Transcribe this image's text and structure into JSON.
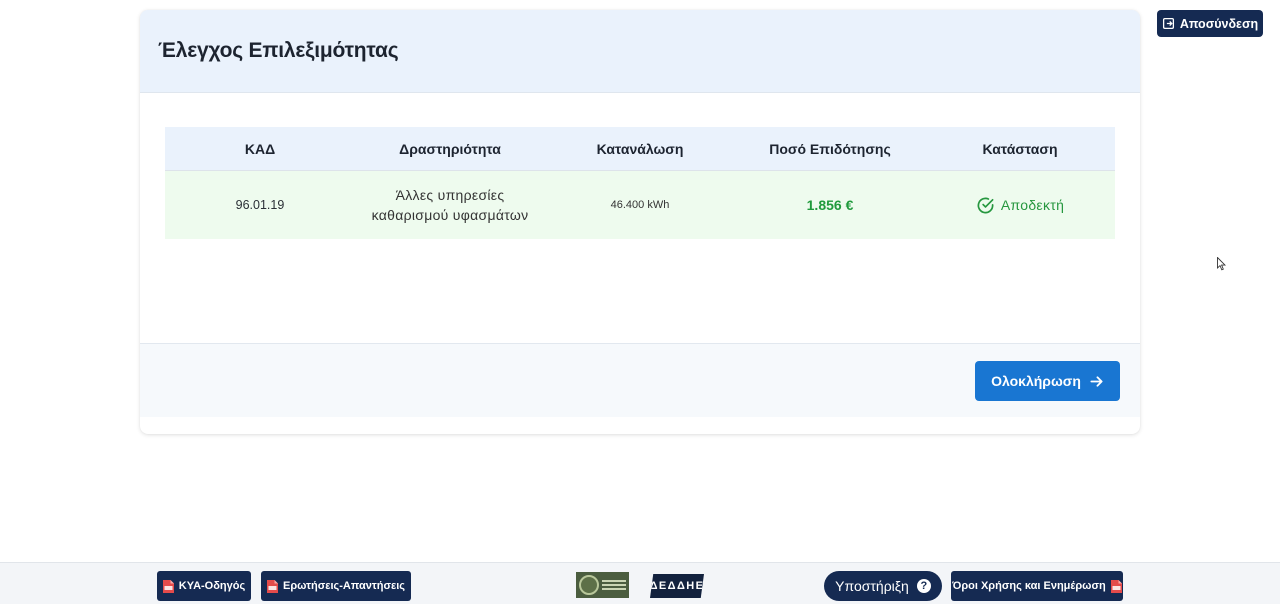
{
  "header": {
    "logout_label": "Αποσύνδεση"
  },
  "card": {
    "title": "Έλεγχος Επιλεξιμότητας",
    "table": {
      "columns": [
        "ΚΑΔ",
        "Δραστηριότητα",
        "Κατανάλωση",
        "Ποσό Επιδότησης",
        "Κατάσταση"
      ],
      "rows": [
        {
          "kad": "96.01.19",
          "activity_line1": "Άλλες υπηρεσίες",
          "activity_line2": "καθαρισμού υφασμάτων",
          "consumption": "46.400 kWh",
          "amount": "1.856 €",
          "status": "Αποδεκτή"
        }
      ]
    },
    "complete_label": "Ολοκλήρωση"
  },
  "footer": {
    "kya_label": "ΚΥΑ-Οδηγός",
    "qa_label": "Ερωτήσεις-Απαντήσεις",
    "support_label": "Υποστήριξη",
    "support_icon_glyph": "?",
    "terms_label": "Όροι Χρήσης και Ενημέρωση",
    "deddie_logo_text": "ΔΕΔΔΗΕ"
  },
  "colors": {
    "navy": "#152a52",
    "primary_blue": "#1976d2",
    "success_green": "#1f9a3c",
    "header_bg": "#eaf2fc",
    "row_bg": "#eefbee"
  },
  "icons": [
    "logout-icon",
    "check-circle-icon",
    "arrow-right-icon",
    "pdf-icon",
    "question-icon",
    "ministry-logo",
    "deddie-logo"
  ]
}
